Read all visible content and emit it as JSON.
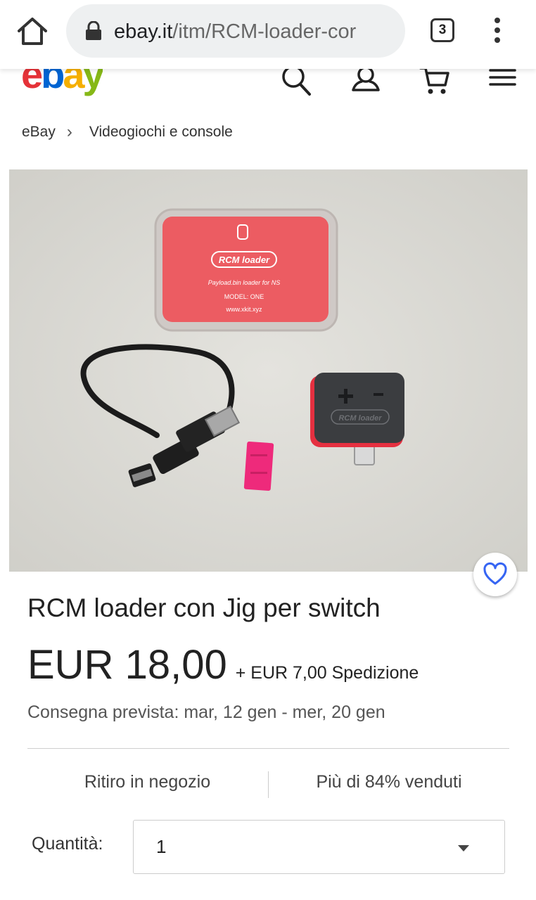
{
  "browser": {
    "url_domain": "ebay.it",
    "url_path": "/itm/RCM-loader-cor",
    "tab_count": "3"
  },
  "header": {
    "logo_letters": [
      "e",
      "b",
      "a",
      "y"
    ]
  },
  "breadcrumb": {
    "items": [
      "eBay",
      "Videogiochi e console"
    ]
  },
  "product": {
    "photo_labels": {
      "box_brand": "RCM loader",
      "box_line1": "Payload.bin loader for NS",
      "box_line2": "MODEL: ONE",
      "box_line3": "www.xkit.xyz",
      "dongle_brand": "RCM loader"
    },
    "title": "RCM loader con Jig per switch",
    "price": "EUR 18,00",
    "shipping": "+ EUR 7,00 Spedizione",
    "delivery": "Consegna prevista: mar, 12 gen - mer, 20 gen",
    "info_left": "Ritiro in negozio",
    "info_right": "Più di 84% venduti"
  },
  "quantity": {
    "label": "Quantità:",
    "value": "1"
  },
  "colors": {
    "ebay_red": "#e53238",
    "ebay_blue": "#0064d2",
    "ebay_yellow": "#f5af02",
    "ebay_green": "#86b817",
    "favorite_blue": "#3665f3"
  }
}
